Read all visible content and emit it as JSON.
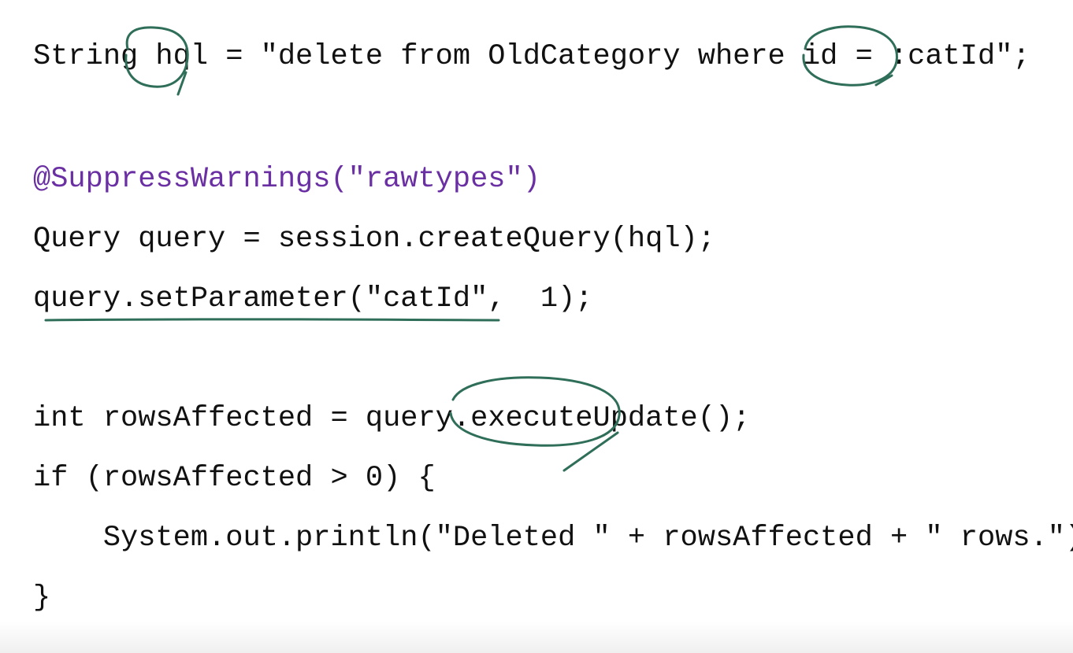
{
  "code": {
    "line1": "String hql = \"delete from OldCategory where id = :catId\";",
    "line2": "@SuppressWarnings(\"rawtypes\")",
    "line3": "Query query = session.createQuery(hql);",
    "line4": "query.setParameter(\"catId\",  1);",
    "line5": "int rowsAffected = query.executeUpdate();",
    "line6": "if (rowsAffected > 0) {",
    "line7": "    System.out.println(\"Deleted \" + rowsAffected + \" rows.\");",
    "line8": "}"
  },
  "colors": {
    "text": "#111111",
    "annotation": "#6a2fa3",
    "ink": "#2f6e58"
  }
}
